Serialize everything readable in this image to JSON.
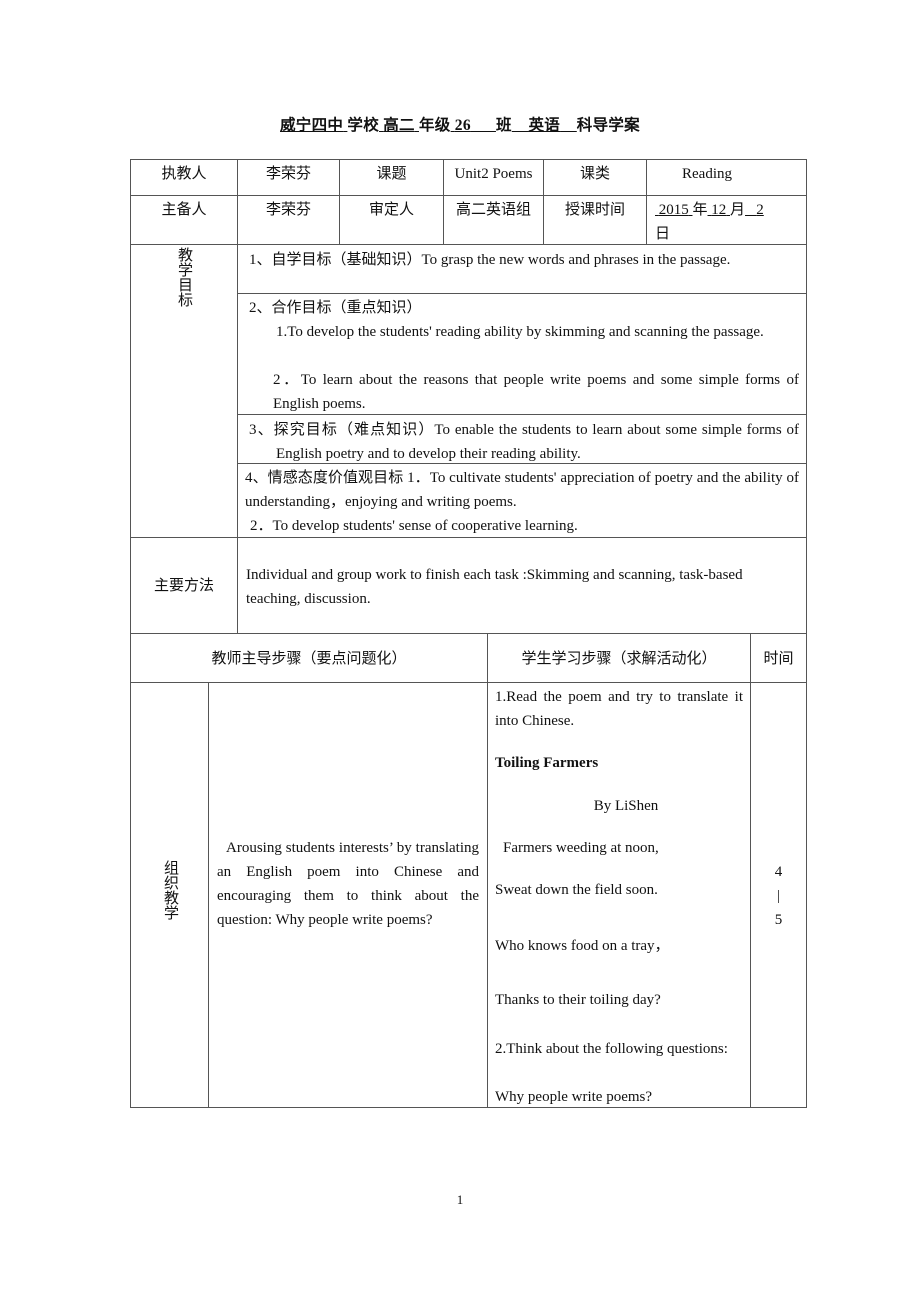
{
  "header": {
    "school": "威宁四中",
    "school_suffix": "学校",
    "grade": "高二",
    "grade_suffix": "年级",
    "class_no": "26",
    "class_suffix": "班",
    "subject": "英语",
    "subject_suffix": "科导学案"
  },
  "info": {
    "teacher_label": "执教人",
    "teacher": "李荣芬",
    "topic_label": "课题",
    "topic": "Unit2 Poems",
    "type_label": "课类",
    "type": "Reading",
    "preparer_label": "主备人",
    "preparer": "李荣芬",
    "reviewer_label": "审定人",
    "reviewer": "高二英语组",
    "time_label": "授课时间",
    "date": {
      "year": "2015",
      "year_unit": "年",
      "month": "12",
      "month_unit": "月",
      "day": "2",
      "day_unit": "日"
    }
  },
  "goals": {
    "label": "教学目标",
    "items": [
      {
        "text": "1、自学目标（基础知识）To grasp the new words and phrases in the passage."
      },
      {
        "heading": "2、合作目标（重点知识）",
        "line1": "1.To develop the students' reading ability by skimming and scanning the passage.",
        "line2": "2．To learn about the reasons that people write poems and some simple forms of English poems."
      },
      {
        "text": "3、探究目标（难点知识）To enable the students to learn about some simple forms of English poetry and to develop their reading ability."
      },
      {
        "text": "4、情感态度价值观目标 1．To cultivate students' appreciation of poetry and the ability of understanding，enjoying and writing poems.",
        "line2": "2．To develop students' sense of cooperative learning."
      }
    ]
  },
  "method": {
    "label": "主要方法",
    "text": "Individual and group work to finish each task :Skimming and scanning, task-based teaching, discussion."
  },
  "steps_header": {
    "teacher_col": "教师主导步骤（要点问题化）",
    "student_col": "学生学习步骤（求解活动化）",
    "time_col": "时间"
  },
  "step1": {
    "stage": "组织教学",
    "teacher_text": "Arousing students interests’ by translating an English poem into Chinese and encouraging them to think about the question: Why people write poems?",
    "student": {
      "task1": "1.Read the poem and try to translate it into Chinese.",
      "poem_title": "Toiling Farmers",
      "poem_author": "By LiShen",
      "poem_lines": [
        "Farmers weeding at noon,",
        "Sweat down the field soon.",
        "Who knows food on a tray，",
        "Thanks to their toiling day?"
      ],
      "task2": "2.Think about the following questions:",
      "question": "Why people write poems?"
    },
    "time": [
      "4",
      "|",
      "5"
    ]
  },
  "page_number": "1"
}
